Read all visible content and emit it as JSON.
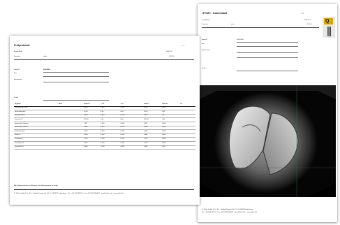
{
  "front_page": {
    "title": "Prüfprotokoll",
    "page_number": "1 / 1",
    "company_field": "[[Logo/Bild]]",
    "date": "04.07.20",
    "time_row_label": "Kunuden",
    "time_row_value": "zeller",
    "time": "13:26:0",
    "ident_label": "Ident-Nr",
    "ident_value": "Z56-Z605-",
    "bez_label": "Bez",
    "kommentar_label": "Kommentar",
    "pruefer_label": "Prüfer",
    "table": {
      "headers": [
        "Eigabeis",
        "Merk",
        "Sollwert",
        "+ Tol.",
        "- Tol.",
        "Istwert",
        "Diff.wert",
        "i.O."
      ],
      "rows": [
        [
          "Einzelmerkm Schei",
          "",
          "0,320",
          "1,000",
          "-1,000",
          "0,320",
          "0,020",
          ""
        ],
        [
          "Hinterkeilwinkel",
          "",
          "26,00",
          "0,50",
          "-0,50",
          "26,02",
          "0,02",
          ""
        ],
        [
          "Kleinfraswinkel",
          "",
          "4,810",
          "0,010",
          "-0,010",
          "4,807",
          "0,0",
          ""
        ],
        [
          "Freiwinkel 1",
          "",
          "152,00",
          "0,50",
          "-0,50",
          "152,00",
          "0,00",
          ""
        ],
        [
          "Spanwinkel Umfang",
          "",
          "0,671",
          "0,050",
          "-0,050",
          "0,671",
          "0,000",
          ""
        ],
        [
          "Spanwinkel radial 2",
          "",
          "0,400",
          "0,050",
          "-0,050",
          "0,400",
          "0,000",
          ""
        ],
        [
          "Keilwinkel Stirn",
          "",
          "0,442",
          "0,050",
          "-0,050",
          "0,442",
          "0,000",
          ""
        ],
        [
          "Radius 1",
          "",
          "0,400",
          "0,100",
          "-0,100",
          "0,401",
          "0,001",
          ""
        ],
        [
          "Fasenbreite",
          "",
          "0,774",
          "0,500",
          "-0,250",
          "0,771",
          "0,003",
          ""
        ],
        [
          "Fasenbreite 1",
          "",
          "0,757",
          "0,100",
          "-0,100",
          "0,777",
          "0,020",
          ""
        ],
        [
          "Fasenbreite 2",
          "",
          "0,680",
          "0,990",
          "-0,990",
          "0,662",
          "0,021",
          ""
        ]
      ]
    },
    "footnote": "Alle [[Sugestionkalme in Millimeter, alle Winkelsinheiten in Grad]]",
    "footer": "E. Zoller GmbH & Co. KG · Gottlieb-Daimler-Str. 19 · D- 74385 Pl. tebahhören · Tel.: +49 7144 8970-0 · Fax +49 7144 8060807 · post@zoller.info · www.zoller.info"
  },
  "back_page": {
    "title": "»PCMI« - Kartentabld",
    "page_number": "1 / 1",
    "date_label": "Lieröfdatum",
    "date_value": "04.07.20 1",
    "kunuden_label": "Kunuden",
    "kunuden_value": "zeler",
    "time_value": "13:26:0",
    "ident_label": "Ident-Nr",
    "ident_value": "Z56-Z605-",
    "bez_label": "Bez",
    "kommentar_label": "Kommentar",
    "pruefer_label": "Prüfer",
    "footer_line1": "E. Zoller GmbH & Co. KG · Gottlieb-Daimler-Str. 19 · D-74385 Pleidelsheim",
    "footer_line2": "Tel. +49 7144 8970-0 · Fax +49 7144 8060807 · post@zoller.info · www.zoller.info"
  },
  "colors": {
    "background": "#ffffff",
    "page": "#ffffff",
    "photo_background": "#050505",
    "logo_accent": "#d8a800"
  }
}
